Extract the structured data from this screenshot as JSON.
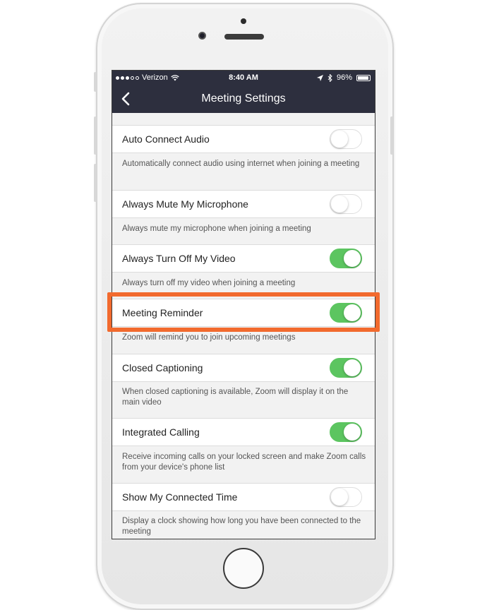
{
  "status_bar": {
    "carrier": "Verizon",
    "time": "8:40 AM",
    "battery": "96%"
  },
  "nav": {
    "title": "Meeting Settings",
    "back_icon": "chevron-left-icon"
  },
  "settings": [
    {
      "label": "Auto Connect Audio",
      "on": false,
      "description": "Automatically connect audio using internet when joining a meeting"
    },
    {
      "label": "Always Mute My Microphone",
      "on": false,
      "description": "Always mute my microphone when joining a meeting"
    },
    {
      "label": "Always Turn Off My Video",
      "on": true,
      "description": "Always turn off my video when joining a meeting"
    },
    {
      "label": "Meeting Reminder",
      "on": true,
      "description": "Zoom will remind you to join upcoming meetings"
    },
    {
      "label": "Closed Captioning",
      "on": true,
      "description": "When closed captioning is available, Zoom will display it on the main video"
    },
    {
      "label": "Integrated Calling",
      "on": true,
      "description": "Receive incoming calls on your locked screen and make Zoom calls from your device's phone list"
    },
    {
      "label": "Show My Connected Time",
      "on": false,
      "description": "Display a clock showing how long you have been connected to the meeting"
    }
  ],
  "colors": {
    "toggle_on": "#5cc560",
    "nav_bg": "#2d2f3e",
    "highlight": "#f26a2e"
  }
}
